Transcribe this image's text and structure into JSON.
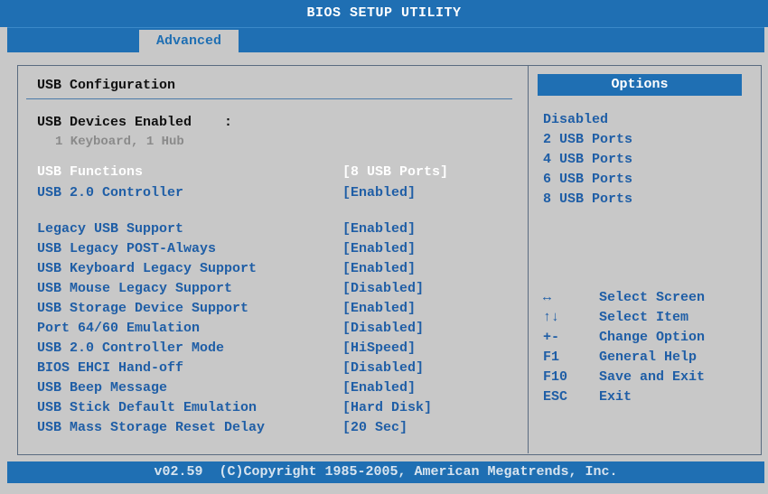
{
  "title": "BIOS SETUP UTILITY",
  "tab": "Advanced",
  "section_title": "USB Configuration",
  "devices": {
    "label": "USB Devices Enabled    :",
    "value": "1 Keyboard, 1 Hub"
  },
  "settings": [
    {
      "name": "USB Functions",
      "value": "[8 USB Ports]",
      "selected": true
    },
    {
      "name": "USB 2.0 Controller",
      "value": "[Enabled]"
    },
    {
      "name": "Legacy USB Support",
      "value": "[Enabled]"
    },
    {
      "name": "USB Legacy POST-Always",
      "value": "[Enabled]"
    },
    {
      "name": "USB Keyboard Legacy Support",
      "value": "[Enabled]"
    },
    {
      "name": "USB Mouse Legacy Support",
      "value": "[Disabled]"
    },
    {
      "name": "USB Storage Device Support",
      "value": "[Enabled]"
    },
    {
      "name": "Port 64/60 Emulation",
      "value": "[Disabled]"
    },
    {
      "name": "USB 2.0 Controller Mode",
      "value": "[HiSpeed]"
    },
    {
      "name": "BIOS EHCI Hand-off",
      "value": "[Disabled]"
    },
    {
      "name": "USB Beep Message",
      "value": "[Enabled]"
    },
    {
      "name": "USB Stick Default Emulation",
      "value": "[Hard Disk]"
    },
    {
      "name": "USB Mass Storage Reset Delay",
      "value": "[20 Sec]"
    }
  ],
  "options_header": "Options",
  "options": [
    "Disabled",
    "2 USB Ports",
    "4 USB Ports",
    "6 USB Ports",
    "8 USB Ports"
  ],
  "hints": [
    {
      "key": "↔",
      "desc": "Select Screen"
    },
    {
      "key": "↑↓",
      "desc": "Select Item"
    },
    {
      "key": "+-",
      "desc": "Change Option"
    },
    {
      "key": "F1",
      "desc": "General Help"
    },
    {
      "key": "F10",
      "desc": "Save and Exit"
    },
    {
      "key": "ESC",
      "desc": "Exit"
    }
  ],
  "footer": "v02.59  (C)Copyright 1985-2005, American Megatrends, Inc.",
  "colors": {
    "accent": "#1f6fb3",
    "background": "#c8c8c8",
    "text_item": "#1f5ea6",
    "text_selected": "#ffffff",
    "text_disabled": "#8a8a8a"
  }
}
